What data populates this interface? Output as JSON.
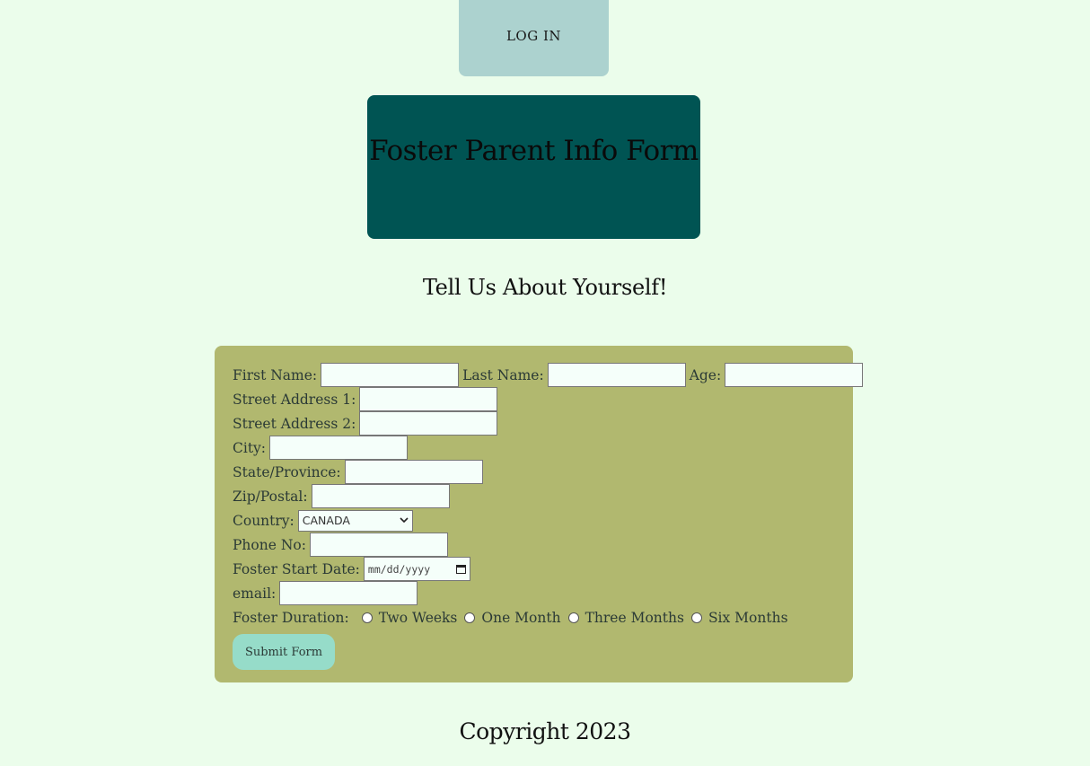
{
  "login": {
    "label": "LOG IN"
  },
  "header": {
    "title": "Foster Parent Info Form"
  },
  "subtitle": "Tell Us About Yourself!",
  "form": {
    "first_name_label": "First Name:",
    "last_name_label": "Last Name:",
    "age_label": "Age:",
    "street1_label": "Street Address 1:",
    "street2_label": "Street Address 2:",
    "city_label": "City:",
    "state_label": "State/Province:",
    "zip_label": "Zip/Postal:",
    "country_label": "Country:",
    "country_value": "CANADA",
    "phone_label": "Phone No:",
    "start_date_label": "Foster Start Date:",
    "start_date_placeholder": "mm/dd/yyyy",
    "email_label": "email:",
    "duration_label": "Foster Duration:",
    "duration_options": [
      "Two Weeks",
      "One Month",
      "Three Months",
      "Six Months"
    ],
    "submit_label": "Submit Form"
  },
  "footer": {
    "copyright": "Copyright 2023"
  },
  "colors": {
    "background": "#ebfdeb",
    "login_button": "#acd2cf",
    "title_box": "#005453",
    "form_panel": "#b1b86f",
    "submit_button": "#96dcc9"
  }
}
